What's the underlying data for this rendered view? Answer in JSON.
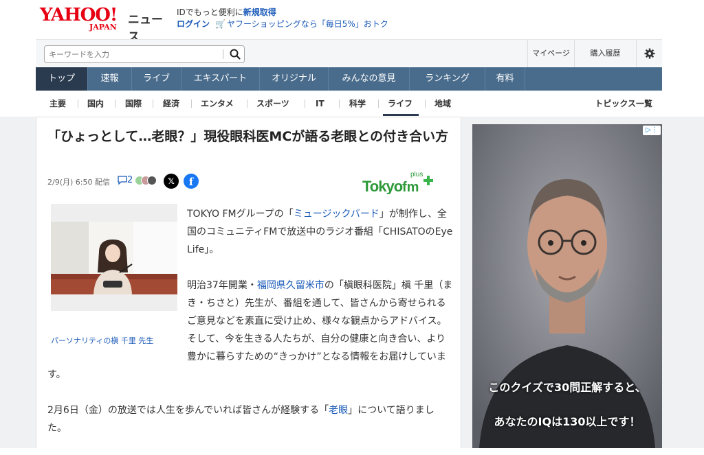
{
  "header": {
    "logo_yahoo": "YAHOO!",
    "logo_japan": "JAPAN",
    "logo_news": "ニュース",
    "promo_line1": "IDでもっと便利に",
    "promo_register": "新規取得",
    "promo_login": "ログイン",
    "promo_shopping": "ヤフーショッピングなら「毎日5%」おトク"
  },
  "search": {
    "placeholder": "キーワードを入力"
  },
  "utility": {
    "mypage": "マイページ",
    "history": "購入履歴"
  },
  "main_nav": [
    {
      "label": "トップ",
      "active": true
    },
    {
      "label": "速報"
    },
    {
      "label": "ライブ"
    },
    {
      "label": "エキスパート"
    },
    {
      "label": "オリジナル"
    },
    {
      "label": "みんなの意見"
    },
    {
      "label": "ランキング"
    },
    {
      "label": "有料"
    }
  ],
  "sub_nav": {
    "items": [
      "主要",
      "国内",
      "国際",
      "経済",
      "エンタメ",
      "スポーツ",
      "IT",
      "科学",
      "ライフ",
      "地域"
    ],
    "active": "ライフ",
    "topics": "トピックス一覧"
  },
  "article": {
    "title": "「ひょっとして…老眼？」現役眼科医MCが語る老眼との付き合い方",
    "meta": "2/9(月) 6:50 配信",
    "comment_count": "2",
    "publisher_logo": "Tokyofm plus",
    "photo_caption": "パーソナリティの槇 千里 先生",
    "p1_a": "TOKYO FMグループの「",
    "p1_link": "ミュージックバード",
    "p1_b": "」が制作し、全国のコミュニティFMで放送中のラジオ番組「CHISATOのEye Life」。",
    "p2_a": "明治37年開業・",
    "p2_link": "福岡県久留米市",
    "p2_b": "の「槇眼科医院」槇 千里（まき・ちさと）先生が、番組を通して、皆さんから寄せられるご意見などを素直に受け止め、様々な観点からアドバイス。そして、今を生きる人たちが、自分の健康と向き合い、より豊かに暮らすための“きっかけ”となる情報をお届けしています。",
    "p3_a": "2月6日（金）の放送では人生を歩んでいれば皆さんが経験する「",
    "p3_link": "老眼",
    "p3_b": "」について語りました。"
  },
  "ad": {
    "line1": "このクイズで30問正解すると、",
    "line2": "あなたのIQは130以上です！"
  },
  "colors": {
    "nav_bg": "#4a6c8c",
    "nav_active": "#2a3b4f",
    "link": "#1a5ab8",
    "brand_red": "#e60012"
  }
}
